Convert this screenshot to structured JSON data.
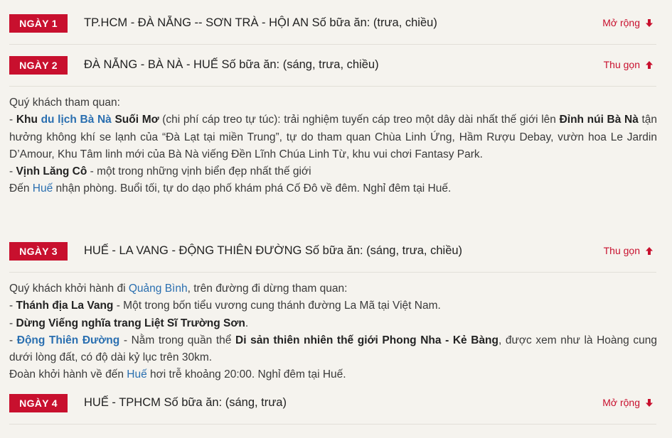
{
  "days": [
    {
      "badge": "NGÀY 1",
      "title": "TP.HCM - ĐÀ NẴNG -- SƠN TRÀ - HỘI AN Số bữa ăn: (trưa, chiều)",
      "toggle": "Mở rộng",
      "toggle_icon": "arrow-down-icon"
    },
    {
      "badge": "NGÀY 2",
      "title": "ĐÀ NẴNG - BÀ NÀ - HUẾ Số bữa ăn: (sáng, trưa, chiều)",
      "toggle": "Thu gọn",
      "toggle_icon": "arrow-up-icon"
    },
    {
      "badge": "NGÀY 3",
      "title": "HUẾ - LA VANG - ĐỘNG THIÊN ĐƯỜNG Số bữa ăn: (sáng, trưa, chiều)",
      "toggle": "Thu gọn",
      "toggle_icon": "arrow-up-icon"
    },
    {
      "badge": "NGÀY 4",
      "title": "HUẾ - TPHCM Số bữa ăn: (sáng, trưa)",
      "toggle": "Mở rộng",
      "toggle_icon": "arrow-down-icon"
    }
  ],
  "day2_desc": {
    "intro": "Quý khách tham quan:",
    "l1_dash": "- ",
    "l1_khu": "Khu ",
    "l1_link": "du lịch Bà Nà",
    "l1_suoimo": " Suối Mơ",
    "l1_text": " (chi phí cáp treo tự túc): trải nghiệm tuyến cáp treo một dây dài nhất thế giới lên ",
    "l1_peak": "Đỉnh núi Bà Nà",
    "l1_rest": " tận hưởng không khí se lạnh của “Đà Lạt tại miền Trung”, tự do tham quan Chùa Linh Ứng, Hầm Rượu Debay, vườn hoa Le Jardin D’Amour, Khu Tâm linh mới của Bà Nà viếng Đền Lĩnh Chúa Linh Từ, khu vui chơi Fantasy Park.",
    "l2_dash": "- ",
    "l2_bold": "Vịnh Lăng Cô",
    "l2_text": " - một trong những vịnh biển đẹp nhất thế giới",
    "l3_pre": "Đến ",
    "l3_link": "Huế",
    "l3_text": " nhận phòng. Buổi tối, tự do dạo phố khám phá Cố Đô về đêm. Nghỉ đêm tại Huế."
  },
  "day3_desc": {
    "l1_pre": "Quý khách khởi hành đi ",
    "l1_link": "Quảng Bình",
    "l1_text": ", trên đường đi dừng tham quan:",
    "l2_dash": "- ",
    "l2_bold": "Thánh địa La Vang",
    "l2_text": " - Một trong bốn tiểu vương cung thánh đường La Mã tại Việt Nam.",
    "l3_dash": "- ",
    "l3_bold": "Dừng Viếng nghĩa trang Liệt Sĩ Trường Sơn",
    "l3_text": ".",
    "l4_dash": "- ",
    "l4_link": "Động Thiên Đường",
    "l4_text": " - Nằm trong quần thể ",
    "l4_bold": "Di sản thiên nhiên thế giới Phong Nha - Kẻ Bàng",
    "l4_rest": ", được xem như là Hoàng cung dưới lòng đất, có độ dài kỷ lục trên 30km.",
    "l5_pre": "Đoàn khởi hành về đến ",
    "l5_link": "Huế",
    "l5_text": " hơi trễ khoảng 20:00. Nghỉ đêm tại Huế."
  },
  "colors": {
    "accent": "#c8102e",
    "link": "#2a6fb0",
    "background": "#f5f3ee"
  }
}
